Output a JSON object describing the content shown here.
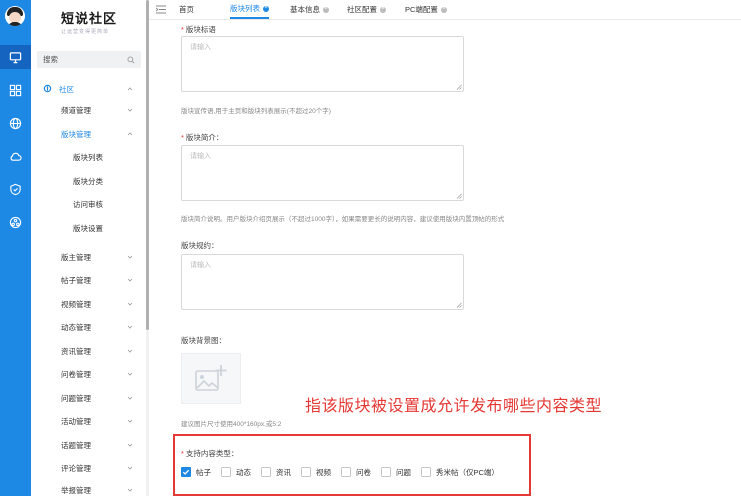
{
  "brand": {
    "title": "短说社区",
    "subtitle": "让运营变得更简单"
  },
  "sidebar": {
    "search_label": "搜索",
    "group": "社区",
    "items": [
      {
        "label": "频道管理"
      },
      {
        "label": "版块管理"
      },
      {
        "label": "版块列表"
      },
      {
        "label": "版块分类"
      },
      {
        "label": "访问审核"
      },
      {
        "label": "版块设置"
      },
      {
        "label": "版主管理"
      },
      {
        "label": "帖子管理"
      },
      {
        "label": "视频管理"
      },
      {
        "label": "动态管理"
      },
      {
        "label": "资讯管理"
      },
      {
        "label": "问卷管理"
      },
      {
        "label": "问题管理"
      },
      {
        "label": "活动管理"
      },
      {
        "label": "话题管理"
      },
      {
        "label": "评论管理"
      },
      {
        "label": "举报管理"
      }
    ]
  },
  "tabs": [
    {
      "label": "首页"
    },
    {
      "label": "版块列表"
    },
    {
      "label": "基本信息"
    },
    {
      "label": "社区配置"
    },
    {
      "label": "PC端配置"
    }
  ],
  "form": {
    "slogan_label": "版块标语",
    "slogan_placeholder": "请输入",
    "slogan_hint": "版块宣传语,用于主页和版块列表展示(不超过20个字)",
    "intro_label": "版块简介",
    "intro_placeholder": "请输入",
    "intro_hint": "版块简介说明。用户版块介绍页展示（不超过1000字），如果需要更长的说明内容，建议使用版块内置顶帖的形式",
    "rules_label": "版块规约",
    "rules_placeholder": "请输入",
    "bg_label": "版块背景图",
    "bg_hint": "建议图片尺寸使用400*160px,或5:2",
    "types_label": "支持内容类型",
    "types": [
      {
        "label": "帖子",
        "checked": true
      },
      {
        "label": "动态",
        "checked": false
      },
      {
        "label": "资讯",
        "checked": false
      },
      {
        "label": "视频",
        "checked": false
      },
      {
        "label": "问卷",
        "checked": false
      },
      {
        "label": "问题",
        "checked": false
      },
      {
        "label": "秀米帖（仅PC端）",
        "checked": false
      }
    ]
  },
  "annotation": "指该版块被设置成允许发布哪些内容类型",
  "colors": {
    "accent": "#1e88e5",
    "annotation_red": "#e53935"
  }
}
